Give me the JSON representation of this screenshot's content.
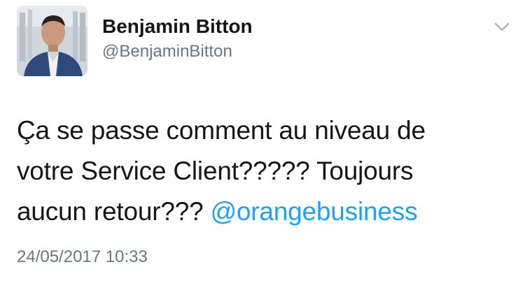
{
  "tweet": {
    "author": {
      "display_name": "Benjamin Bitton",
      "handle": "@BenjaminBitton"
    },
    "icons": {
      "menu": "chevron-down-icon"
    },
    "text_lines": [
      "Ça se passe comment au niveau de",
      "votre Service Client????? Toujours",
      "aucun retour??? "
    ],
    "mention": "@orangebusiness",
    "timestamp": "24/05/2017 10:33",
    "colors": {
      "mention": "#1da1f2",
      "secondary_text": "#657786",
      "primary_text": "#14171a"
    }
  }
}
